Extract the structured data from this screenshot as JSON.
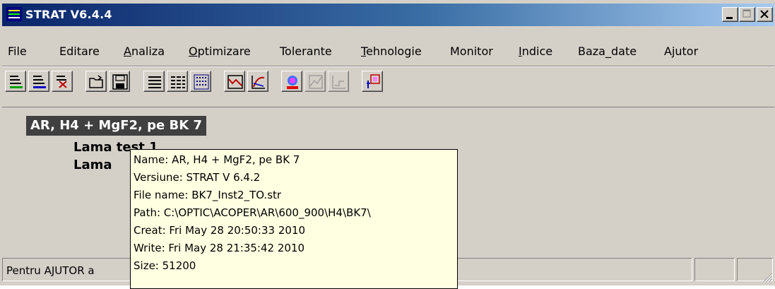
{
  "window": {
    "title": "STRAT V6.4.4",
    "icon": "strat-app-icon",
    "controls": [
      "minimize-icon",
      "maximize-icon",
      "close-icon"
    ]
  },
  "menu": [
    {
      "label": "File"
    },
    {
      "label": "Editare"
    },
    {
      "label": "Analiza",
      "mnemonic": "A"
    },
    {
      "label": "Optimizare",
      "mnemonic": "O"
    },
    {
      "label": "Tolerante"
    },
    {
      "label": "Tehnologie",
      "mnemonic": "T"
    },
    {
      "label": "Monitor"
    },
    {
      "label": "Indice",
      "mnemonic": "I"
    },
    {
      "label": "Baza_date"
    },
    {
      "label": "Ajutor"
    }
  ],
  "toolbar": [
    "layers-green-icon",
    "layers-blue-icon",
    "layers-delete-icon",
    "open-folder-icon",
    "save-disk-icon",
    "list-view-icon",
    "grid-view-icon",
    "table-view-icon",
    "spectrum-chart-icon",
    "curve-plot-icon",
    "color-wheel-icon",
    "disabled-chart-icon",
    "disabled-graph-icon",
    "export-icon"
  ],
  "tree": {
    "selected": "AR, H4 + MgF2, pe BK 7",
    "children": [
      "Lama test 1",
      "Lama"
    ]
  },
  "tooltip": {
    "name": "Name: AR, H4 + MgF2, pe BK 7",
    "version": "Versiune: STRAT V 6.4.2",
    "file": "File name: BK7_Inst2_TO.str",
    "path": "Path: C:\\OPTIC\\ACOPER\\AR\\600_900\\H4\\BK7\\",
    "created": "Creat: Fri May 28 20:50:33 2010",
    "written": "Write: Fri May 28 21:35:42 2010",
    "size": "Size: 51200"
  },
  "status": {
    "help_text": "Pentru AJUTOR a"
  }
}
